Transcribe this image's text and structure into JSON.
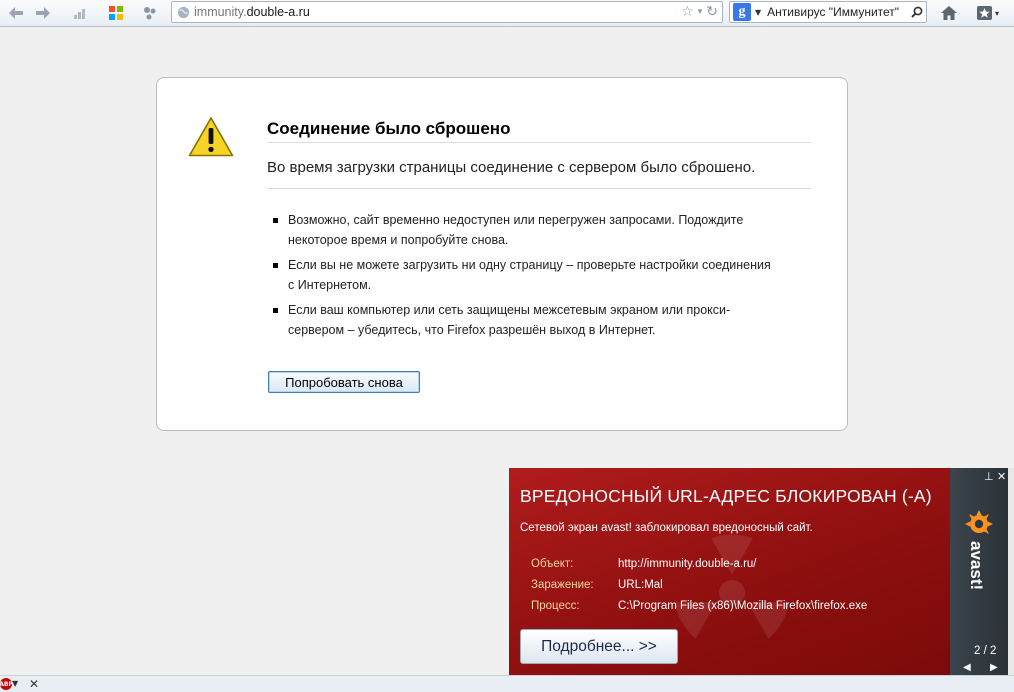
{
  "toolbar": {
    "back_icon": "back-arrow-icon",
    "forward_icon": "forward-arrow-icon",
    "url_prefix": "immunity.",
    "url_domain": "double-a.ru",
    "search_text": "Антивирус \"Иммунитет\""
  },
  "error_page": {
    "title": "Соединение было сброшено",
    "short_desc": "Во время загрузки страницы соединение с сервером было сброшено.",
    "bullets": [
      "Возможно, сайт временно недоступен или перегружен запросами. Подождите некоторое время и попробуйте снова.",
      "Если вы не можете загрузить ни одну страницу – проверьте настройки соединения с Интернетом.",
      "Если ваш компьютер или сеть защищены межсетевым экраном или прокси-сервером – убедитесь, что Firefox разрешён выход в Интернет."
    ],
    "retry_label": "Попробовать снова"
  },
  "avast": {
    "title": "ВРЕДОНОСНЫЙ URL-АДРЕС БЛОКИРОВАН (-A)",
    "subtitle": "Сетевой экран avast! заблокировал вредоносный сайт.",
    "details": [
      {
        "label": "Объект:",
        "value": "http://immunity.double-a.ru/"
      },
      {
        "label": "Заражение:",
        "value": "URL:Mal"
      },
      {
        "label": "Процесс:",
        "value": "C:\\Program Files (x86)\\Mozilla Firefox\\firefox.exe"
      }
    ],
    "more_label": "Подробнее... >>",
    "page_counter": "2 / 2",
    "brand": "avast!",
    "pin_glyph": "⊥",
    "close_glyph": "✕"
  },
  "statusbar": {
    "abp_label": "ABP",
    "close_glyph": "✕"
  },
  "colors": {
    "popup_red": "#9e1414",
    "popup_label": "#f2d79e",
    "avast_orange": "#f7931e",
    "warning_yellow": "#f5d327"
  }
}
